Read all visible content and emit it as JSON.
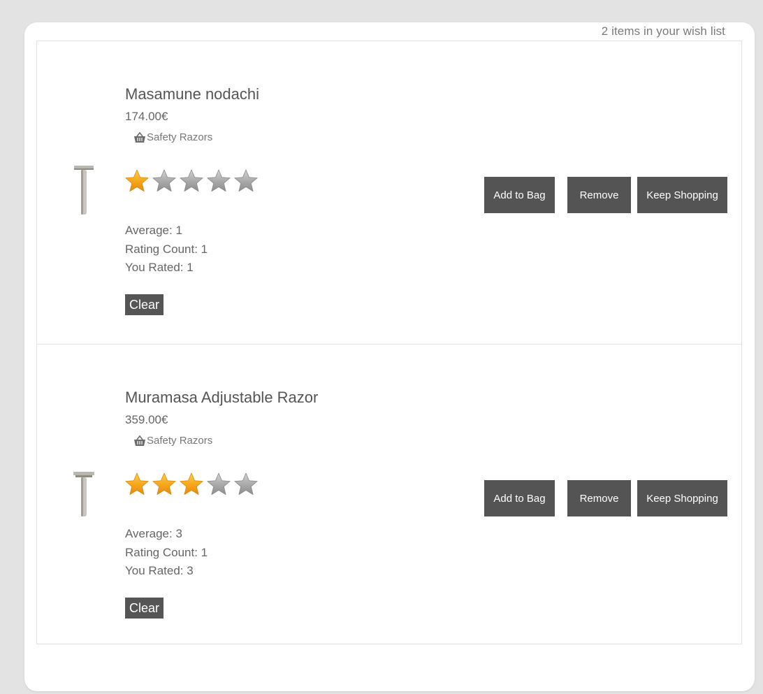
{
  "wishlist": {
    "count_label": "2 items in your wish list",
    "items": [
      {
        "name": "Masamune nodachi",
        "price": "174.00€",
        "category": "Safety Razors",
        "rating_filled": 1,
        "rating_max": 5,
        "average": "Average: 1",
        "rating_count": "Rating Count: 1",
        "you_rated": "You Rated: 1",
        "clear_label": "Clear",
        "add_label": "Add to Bag",
        "remove_label": "Remove",
        "keep_label": "Keep Shopping"
      },
      {
        "name": "Muramasa Adjustable Razor",
        "price": "359.00€",
        "category": "Safety Razors",
        "rating_filled": 3,
        "rating_max": 5,
        "average": "Average: 3",
        "rating_count": "Rating Count: 1",
        "you_rated": "You Rated: 3",
        "clear_label": "Clear",
        "add_label": "Add to Bag",
        "remove_label": "Remove",
        "keep_label": "Keep Shopping"
      }
    ]
  },
  "icons": {
    "category_icon": "basket-icon",
    "star_icon": "star-icon",
    "product_icon": "razor-icon"
  },
  "colors": {
    "button_bg": "#545454",
    "star_filled": "#f7a519",
    "star_empty": "#a8a8a8"
  }
}
